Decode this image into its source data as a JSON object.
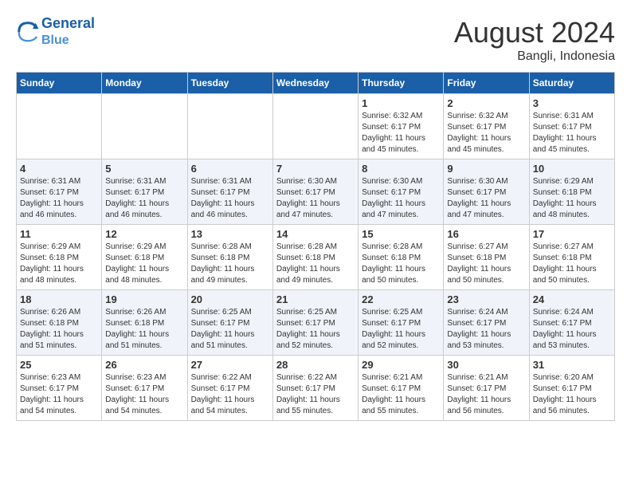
{
  "header": {
    "logo_line1": "General",
    "logo_line2": "Blue",
    "month_year": "August 2024",
    "location": "Bangli, Indonesia"
  },
  "weekdays": [
    "Sunday",
    "Monday",
    "Tuesday",
    "Wednesday",
    "Thursday",
    "Friday",
    "Saturday"
  ],
  "weeks": [
    [
      {
        "day": "",
        "info": ""
      },
      {
        "day": "",
        "info": ""
      },
      {
        "day": "",
        "info": ""
      },
      {
        "day": "",
        "info": ""
      },
      {
        "day": "1",
        "info": "Sunrise: 6:32 AM\nSunset: 6:17 PM\nDaylight: 11 hours\nand 45 minutes."
      },
      {
        "day": "2",
        "info": "Sunrise: 6:32 AM\nSunset: 6:17 PM\nDaylight: 11 hours\nand 45 minutes."
      },
      {
        "day": "3",
        "info": "Sunrise: 6:31 AM\nSunset: 6:17 PM\nDaylight: 11 hours\nand 45 minutes."
      }
    ],
    [
      {
        "day": "4",
        "info": "Sunrise: 6:31 AM\nSunset: 6:17 PM\nDaylight: 11 hours\nand 46 minutes."
      },
      {
        "day": "5",
        "info": "Sunrise: 6:31 AM\nSunset: 6:17 PM\nDaylight: 11 hours\nand 46 minutes."
      },
      {
        "day": "6",
        "info": "Sunrise: 6:31 AM\nSunset: 6:17 PM\nDaylight: 11 hours\nand 46 minutes."
      },
      {
        "day": "7",
        "info": "Sunrise: 6:30 AM\nSunset: 6:17 PM\nDaylight: 11 hours\nand 47 minutes."
      },
      {
        "day": "8",
        "info": "Sunrise: 6:30 AM\nSunset: 6:17 PM\nDaylight: 11 hours\nand 47 minutes."
      },
      {
        "day": "9",
        "info": "Sunrise: 6:30 AM\nSunset: 6:17 PM\nDaylight: 11 hours\nand 47 minutes."
      },
      {
        "day": "10",
        "info": "Sunrise: 6:29 AM\nSunset: 6:18 PM\nDaylight: 11 hours\nand 48 minutes."
      }
    ],
    [
      {
        "day": "11",
        "info": "Sunrise: 6:29 AM\nSunset: 6:18 PM\nDaylight: 11 hours\nand 48 minutes."
      },
      {
        "day": "12",
        "info": "Sunrise: 6:29 AM\nSunset: 6:18 PM\nDaylight: 11 hours\nand 48 minutes."
      },
      {
        "day": "13",
        "info": "Sunrise: 6:28 AM\nSunset: 6:18 PM\nDaylight: 11 hours\nand 49 minutes."
      },
      {
        "day": "14",
        "info": "Sunrise: 6:28 AM\nSunset: 6:18 PM\nDaylight: 11 hours\nand 49 minutes."
      },
      {
        "day": "15",
        "info": "Sunrise: 6:28 AM\nSunset: 6:18 PM\nDaylight: 11 hours\nand 50 minutes."
      },
      {
        "day": "16",
        "info": "Sunrise: 6:27 AM\nSunset: 6:18 PM\nDaylight: 11 hours\nand 50 minutes."
      },
      {
        "day": "17",
        "info": "Sunrise: 6:27 AM\nSunset: 6:18 PM\nDaylight: 11 hours\nand 50 minutes."
      }
    ],
    [
      {
        "day": "18",
        "info": "Sunrise: 6:26 AM\nSunset: 6:18 PM\nDaylight: 11 hours\nand 51 minutes."
      },
      {
        "day": "19",
        "info": "Sunrise: 6:26 AM\nSunset: 6:18 PM\nDaylight: 11 hours\nand 51 minutes."
      },
      {
        "day": "20",
        "info": "Sunrise: 6:25 AM\nSunset: 6:17 PM\nDaylight: 11 hours\nand 51 minutes."
      },
      {
        "day": "21",
        "info": "Sunrise: 6:25 AM\nSunset: 6:17 PM\nDaylight: 11 hours\nand 52 minutes."
      },
      {
        "day": "22",
        "info": "Sunrise: 6:25 AM\nSunset: 6:17 PM\nDaylight: 11 hours\nand 52 minutes."
      },
      {
        "day": "23",
        "info": "Sunrise: 6:24 AM\nSunset: 6:17 PM\nDaylight: 11 hours\nand 53 minutes."
      },
      {
        "day": "24",
        "info": "Sunrise: 6:24 AM\nSunset: 6:17 PM\nDaylight: 11 hours\nand 53 minutes."
      }
    ],
    [
      {
        "day": "25",
        "info": "Sunrise: 6:23 AM\nSunset: 6:17 PM\nDaylight: 11 hours\nand 54 minutes."
      },
      {
        "day": "26",
        "info": "Sunrise: 6:23 AM\nSunset: 6:17 PM\nDaylight: 11 hours\nand 54 minutes."
      },
      {
        "day": "27",
        "info": "Sunrise: 6:22 AM\nSunset: 6:17 PM\nDaylight: 11 hours\nand 54 minutes."
      },
      {
        "day": "28",
        "info": "Sunrise: 6:22 AM\nSunset: 6:17 PM\nDaylight: 11 hours\nand 55 minutes."
      },
      {
        "day": "29",
        "info": "Sunrise: 6:21 AM\nSunset: 6:17 PM\nDaylight: 11 hours\nand 55 minutes."
      },
      {
        "day": "30",
        "info": "Sunrise: 6:21 AM\nSunset: 6:17 PM\nDaylight: 11 hours\nand 56 minutes."
      },
      {
        "day": "31",
        "info": "Sunrise: 6:20 AM\nSunset: 6:17 PM\nDaylight: 11 hours\nand 56 minutes."
      }
    ]
  ]
}
